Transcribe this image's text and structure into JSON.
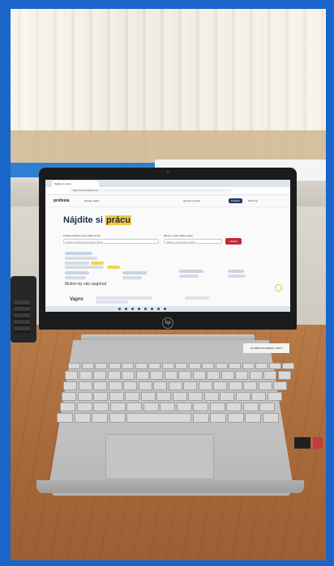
{
  "scene": "laptop-on-desk",
  "browser": {
    "tab_title": "Najdite si prácu",
    "url": "https://www.profesia.sk"
  },
  "site": {
    "logo": "profesia",
    "nav": [
      "Ponuky práce",
      "Vytvoriť si profil",
      "Prihlásiť",
      "Pre firmy"
    ],
    "hero_text": "Nájdite si ",
    "hero_highlight": "prácu",
    "search_what_label": "Pozícia, kľúčové slovo alebo firma",
    "search_what_placeholder": "Pozícia, kľúčové slovo alebo firma",
    "search_where_label": "Miesto, mesto alebo región",
    "search_where_placeholder": "Miesto, mesto alebo región",
    "search_button": "Hľadať",
    "subheading": "Možno by vás zaujímal",
    "partner_logo": "Vapro"
  },
  "laptop": {
    "brand": "hp",
    "sticker": "NOTEBOOK ENERGY CERT"
  },
  "colors": {
    "frame": "#1a66c8",
    "desk": "#a86a3b",
    "accent_highlight": "#f3c740",
    "search_button": "#c2283a"
  }
}
